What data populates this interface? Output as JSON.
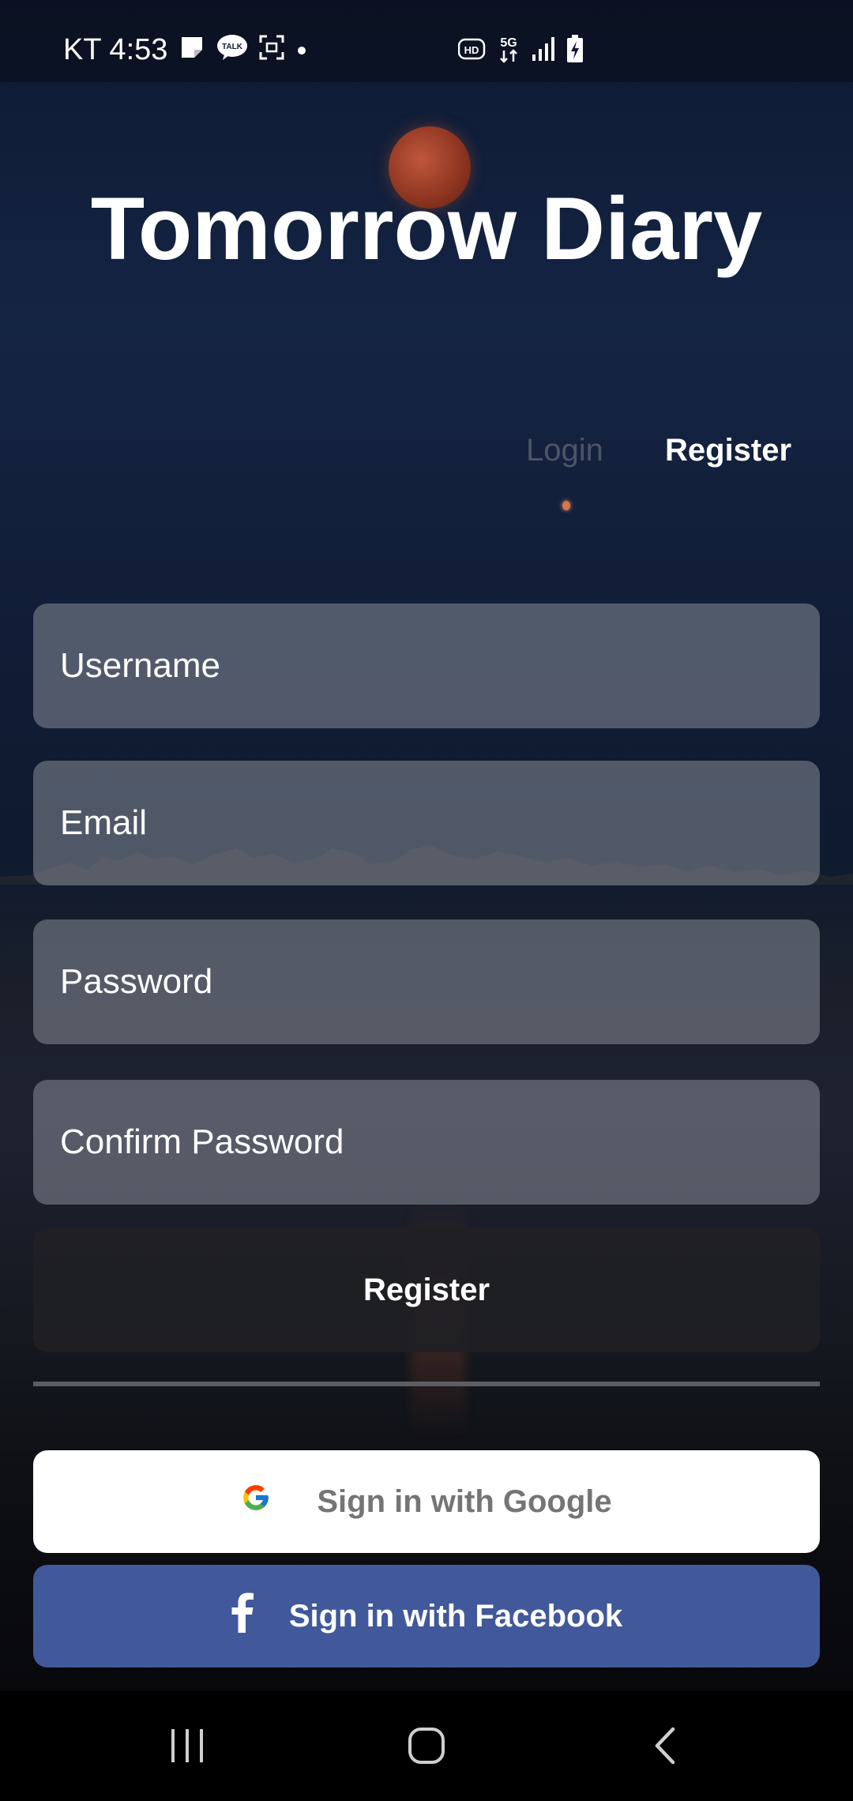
{
  "status_bar": {
    "carrier_time": "KT 4:53",
    "left_icons": [
      "note-icon",
      "talk-icon",
      "screenshot-icon",
      "dot-icon"
    ],
    "talk_label": "TALK",
    "right_icons": [
      "hd-icon",
      "5g-icon",
      "signal-icon",
      "battery-charging-icon"
    ],
    "hd_label": "HD",
    "network_label": "5G"
  },
  "app": {
    "title": "Tomorrow Diary"
  },
  "tabs": {
    "login_label": "Login",
    "register_label": "Register",
    "active": "Register"
  },
  "form": {
    "username_placeholder": "Username",
    "email_placeholder": "Email",
    "password_placeholder": "Password",
    "confirm_password_placeholder": "Confirm Password",
    "submit_label": "Register"
  },
  "social": {
    "google_label": "Sign in with Google",
    "facebook_label": "Sign in with Facebook",
    "google_icon": "google-icon",
    "facebook_icon": "facebook-icon"
  },
  "nav_bar": {
    "items": [
      "recent-apps-icon",
      "home-icon",
      "back-icon"
    ]
  },
  "colors": {
    "facebook_blue": "#41599a",
    "google_text": "#757575",
    "field_bg": "#878c98",
    "register_button_bg": "#202024"
  }
}
